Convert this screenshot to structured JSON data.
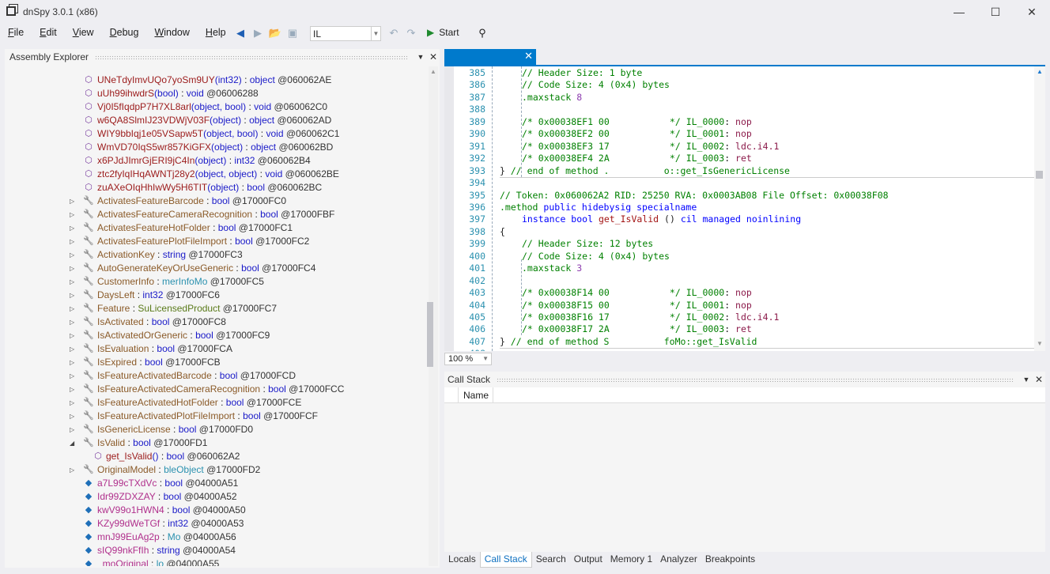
{
  "window": {
    "title": "dnSpy 3.0.1 (x86)"
  },
  "menu": [
    {
      "u": "F",
      "rest": "ile"
    },
    {
      "u": "E",
      "rest": "dit"
    },
    {
      "u": "V",
      "rest": "iew"
    },
    {
      "u": "D",
      "rest": "ebug"
    },
    {
      "u": "W",
      "rest": "indow"
    },
    {
      "u": "H",
      "rest": "elp"
    }
  ],
  "toolbar": {
    "language": "IL",
    "start_label": "Start"
  },
  "assembly_explorer": {
    "title": "Assembly Explorer",
    "items": [
      {
        "kind": "method",
        "level": 2,
        "name": "UNeTdyImvUQo7yoSm9UY",
        "params": "(int32)",
        "type": "object",
        "token": "@060062AE"
      },
      {
        "kind": "method",
        "level": 2,
        "name": "uUh99ihwdrS",
        "params": "(bool)",
        "type": "void",
        "token": "@06006288"
      },
      {
        "kind": "method",
        "level": 2,
        "name": "Vj0I5fIqdpP7H7XL8arl",
        "params": "(object, bool)",
        "type": "void",
        "token": "@060062C0"
      },
      {
        "kind": "method",
        "level": 2,
        "name": "w6QA8SlmIJ23VDWjV03F",
        "params": "(object)",
        "type": "object",
        "token": "@060062AD"
      },
      {
        "kind": "method",
        "level": 2,
        "name": "WIY9bbIqj1e05VSapw5T",
        "params": "(object, bool)",
        "type": "void",
        "token": "@060062C1"
      },
      {
        "kind": "method",
        "level": 2,
        "name": "WmVD70IqS5wr857KiGFX",
        "params": "(object)",
        "type": "object",
        "token": "@060062BD"
      },
      {
        "kind": "method",
        "level": 2,
        "name": "x6PJdJImrGjERI9jC4In",
        "params": "(object)",
        "type": "int32",
        "token": "@060062B4"
      },
      {
        "kind": "method",
        "level": 2,
        "name": "ztc2fyIqIHqAWNTj28y2",
        "params": "(object, object)",
        "type": "void",
        "token": "@060062BE"
      },
      {
        "kind": "method",
        "level": 2,
        "name": "zuAXeOIqHhIwWy5H6TIT",
        "params": "(object)",
        "type": "bool",
        "token": "@060062BC"
      },
      {
        "kind": "prop",
        "level": 1,
        "name": "ActivatesFeatureBarcode",
        "type": "bool",
        "token": "@17000FC0"
      },
      {
        "kind": "prop",
        "level": 1,
        "name": "ActivatesFeatureCameraRecognition",
        "type": "bool",
        "token": "@17000FBF"
      },
      {
        "kind": "prop",
        "level": 1,
        "name": "ActivatesFeatureHotFolder",
        "type": "bool",
        "token": "@17000FC1"
      },
      {
        "kind": "prop",
        "level": 1,
        "name": "ActivatesFeaturePlotFileImport",
        "type": "bool",
        "token": "@17000FC2"
      },
      {
        "kind": "prop",
        "level": 1,
        "name": "ActivationKey",
        "type": "string",
        "token": "@17000FC3"
      },
      {
        "kind": "prop",
        "level": 1,
        "name": "AutoGenerateKeyOrUseGeneric",
        "type": "bool",
        "token": "@17000FC4"
      },
      {
        "kind": "prop",
        "level": 1,
        "name": "CustomerInfo",
        "type": "merInfoMo",
        "typeclass": "type",
        "token": "@17000FC5"
      },
      {
        "kind": "prop",
        "level": 1,
        "name": "DaysLeft",
        "type": "int32",
        "token": "@17000FC6"
      },
      {
        "kind": "prop",
        "level": 1,
        "name": "Feature",
        "type": "SuLicensedProduct",
        "typeclass": "green",
        "token": "@17000FC7"
      },
      {
        "kind": "prop",
        "level": 1,
        "name": "IsActivated",
        "type": "bool",
        "token": "@17000FC8"
      },
      {
        "kind": "prop",
        "level": 1,
        "name": "IsActivatedOrGeneric",
        "type": "bool",
        "token": "@17000FC9"
      },
      {
        "kind": "prop",
        "level": 1,
        "name": "IsEvaluation",
        "type": "bool",
        "token": "@17000FCA"
      },
      {
        "kind": "prop",
        "level": 1,
        "name": "IsExpired",
        "type": "bool",
        "token": "@17000FCB"
      },
      {
        "kind": "prop",
        "level": 1,
        "name": "IsFeatureActivatedBarcode",
        "type": "bool",
        "token": "@17000FCD"
      },
      {
        "kind": "prop",
        "level": 1,
        "name": "IsFeatureActivatedCameraRecognition",
        "type": "bool",
        "token": "@17000FCC"
      },
      {
        "kind": "prop",
        "level": 1,
        "name": "IsFeatureActivatedHotFolder",
        "type": "bool",
        "token": "@17000FCE"
      },
      {
        "kind": "prop",
        "level": 1,
        "name": "IsFeatureActivatedPlotFileImport",
        "type": "bool",
        "token": "@17000FCF"
      },
      {
        "kind": "prop",
        "level": 1,
        "name": "IsGenericLicense",
        "type": "bool",
        "token": "@17000FD0"
      },
      {
        "kind": "prop",
        "level": 1,
        "name": "IsValid",
        "type": "bool",
        "token": "@17000FD1",
        "expanded": true
      },
      {
        "kind": "getter",
        "level": 2,
        "name": "get_IsValid",
        "params": "()",
        "type": "bool",
        "token": "@060062A2"
      },
      {
        "kind": "prop",
        "level": 1,
        "name": "OriginalModel",
        "type": "bleObject",
        "typeclass": "type",
        "token": "@17000FD2"
      },
      {
        "kind": "field",
        "level": 1,
        "name": "a7L99cTXdVc",
        "type": "bool",
        "token": "@04000A51"
      },
      {
        "kind": "field",
        "level": 1,
        "name": "Idr99ZDXZAY",
        "type": "bool",
        "token": "@04000A52"
      },
      {
        "kind": "field",
        "level": 1,
        "name": "kwV99o1HWN4",
        "type": "bool",
        "token": "@04000A50"
      },
      {
        "kind": "field",
        "level": 1,
        "name": "KZy99dWeTGf",
        "type": "int32",
        "token": "@04000A53"
      },
      {
        "kind": "field",
        "level": 1,
        "name": "mnJ99EuAg2p",
        "type": "Mo",
        "typeclass": "type",
        "token": "@04000A56"
      },
      {
        "kind": "field",
        "level": 1,
        "name": "sIQ99nkFfIh",
        "type": "string",
        "token": "@04000A54"
      },
      {
        "kind": "field",
        "level": 1,
        "name": "_moOriginal",
        "type": "lo",
        "typeclass": "type",
        "token": "@04000A55"
      }
    ]
  },
  "editor": {
    "zoom": "100 %",
    "lines": [
      {
        "n": "385",
        "ind": 2,
        "s": [
          [
            "cm",
            "// Header Size: 1 byte"
          ]
        ]
      },
      {
        "n": "386",
        "ind": 2,
        "s": [
          [
            "cm",
            "// Code Size: 4 (0x4) bytes"
          ]
        ]
      },
      {
        "n": "387",
        "ind": 2,
        "s": [
          [
            "cm",
            ".maxstack "
          ],
          [
            "num",
            "8"
          ]
        ]
      },
      {
        "n": "388",
        "ind": 0,
        "s": []
      },
      {
        "n": "389",
        "ind": 2,
        "s": [
          [
            "cm",
            "/* 0x00038EF1 00           */ IL_0000"
          ],
          [
            "pl",
            ": "
          ],
          [
            "op",
            "nop"
          ]
        ]
      },
      {
        "n": "390",
        "ind": 2,
        "s": [
          [
            "cm",
            "/* 0x00038EF2 00           */ IL_0001"
          ],
          [
            "pl",
            ": "
          ],
          [
            "op",
            "nop"
          ]
        ]
      },
      {
        "n": "391",
        "ind": 2,
        "s": [
          [
            "cm",
            "/* 0x00038EF3 17           */ IL_0002"
          ],
          [
            "pl",
            ": "
          ],
          [
            "op",
            "ldc.i4.1"
          ]
        ]
      },
      {
        "n": "392",
        "ind": 2,
        "s": [
          [
            "cm",
            "/* 0x00038EF4 2A           */ IL_0003"
          ],
          [
            "pl",
            ": "
          ],
          [
            "op",
            "ret"
          ]
        ]
      },
      {
        "n": "393",
        "ind": 0,
        "s": [
          [
            "pl",
            "} "
          ],
          [
            "cm",
            "// end of method .          o::get_IsGenericLicense"
          ]
        ]
      },
      {
        "n": "394",
        "ind": 0,
        "s": []
      },
      {
        "n": "395",
        "ind": 0,
        "s": [
          [
            "cm",
            "// Token: 0x060062A2 RID: 25250 RVA: 0x0003AB08 File Offset: 0x00038F08"
          ]
        ]
      },
      {
        "n": "396",
        "ind": 0,
        "s": [
          [
            "cm",
            ".method "
          ],
          [
            "kw",
            "public hidebysig specialname"
          ]
        ]
      },
      {
        "n": "397",
        "ind": 2,
        "s": [
          [
            "kw",
            "instance bool "
          ],
          [
            "id",
            "get_IsValid"
          ],
          [
            "pl",
            " () "
          ],
          [
            "kw",
            "cil managed noinlining"
          ]
        ]
      },
      {
        "n": "398",
        "ind": 0,
        "s": [
          [
            "pl",
            "{"
          ]
        ]
      },
      {
        "n": "399",
        "ind": 2,
        "s": [
          [
            "cm",
            "// Header Size: 12 bytes"
          ]
        ]
      },
      {
        "n": "400",
        "ind": 2,
        "s": [
          [
            "cm",
            "// Code Size: 4 (0x4) bytes"
          ]
        ]
      },
      {
        "n": "401",
        "ind": 2,
        "s": [
          [
            "cm",
            ".maxstack "
          ],
          [
            "num",
            "3"
          ]
        ]
      },
      {
        "n": "402",
        "ind": 0,
        "s": []
      },
      {
        "n": "403",
        "ind": 2,
        "s": [
          [
            "cm",
            "/* 0x00038F14 00           */ IL_0000"
          ],
          [
            "pl",
            ": "
          ],
          [
            "op",
            "nop"
          ]
        ]
      },
      {
        "n": "404",
        "ind": 2,
        "s": [
          [
            "cm",
            "/* 0x00038F15 00           */ IL_0001"
          ],
          [
            "pl",
            ": "
          ],
          [
            "op",
            "nop"
          ]
        ]
      },
      {
        "n": "405",
        "ind": 2,
        "s": [
          [
            "cm",
            "/* 0x00038F16 17           */ IL_0002"
          ],
          [
            "pl",
            ": "
          ],
          [
            "op",
            "ldc.i4.1"
          ]
        ]
      },
      {
        "n": "406",
        "ind": 2,
        "s": [
          [
            "cm",
            "/* 0x00038F17 2A           */ IL_0003"
          ],
          [
            "pl",
            ": "
          ],
          [
            "op",
            "ret"
          ]
        ]
      },
      {
        "n": "407",
        "ind": 0,
        "s": [
          [
            "pl",
            "} "
          ],
          [
            "cm",
            "// end of method S          foMo::get_IsValid"
          ]
        ]
      },
      {
        "n": "408",
        "ind": 0,
        "s": []
      }
    ]
  },
  "call_stack": {
    "title": "Call Stack",
    "columns": [
      "Name"
    ]
  },
  "bottom_tabs": [
    {
      "label": "Locals"
    },
    {
      "label": "Call Stack",
      "active": true
    },
    {
      "label": "Search"
    },
    {
      "label": "Output"
    },
    {
      "label": "Memory 1"
    },
    {
      "label": "Analyzer"
    },
    {
      "label": "Breakpoints"
    }
  ]
}
